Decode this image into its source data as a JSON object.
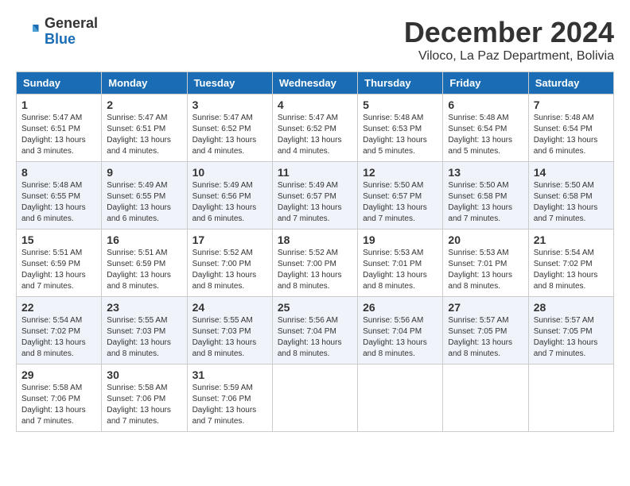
{
  "header": {
    "logo_general": "General",
    "logo_blue": "Blue",
    "month_title": "December 2024",
    "location": "Viloco, La Paz Department, Bolivia"
  },
  "weekdays": [
    "Sunday",
    "Monday",
    "Tuesday",
    "Wednesday",
    "Thursday",
    "Friday",
    "Saturday"
  ],
  "weeks": [
    [
      {
        "day": "1",
        "sunrise": "5:47 AM",
        "sunset": "6:51 PM",
        "daylight": "13 hours and 3 minutes."
      },
      {
        "day": "2",
        "sunrise": "5:47 AM",
        "sunset": "6:51 PM",
        "daylight": "13 hours and 4 minutes."
      },
      {
        "day": "3",
        "sunrise": "5:47 AM",
        "sunset": "6:52 PM",
        "daylight": "13 hours and 4 minutes."
      },
      {
        "day": "4",
        "sunrise": "5:47 AM",
        "sunset": "6:52 PM",
        "daylight": "13 hours and 4 minutes."
      },
      {
        "day": "5",
        "sunrise": "5:48 AM",
        "sunset": "6:53 PM",
        "daylight": "13 hours and 5 minutes."
      },
      {
        "day": "6",
        "sunrise": "5:48 AM",
        "sunset": "6:54 PM",
        "daylight": "13 hours and 5 minutes."
      },
      {
        "day": "7",
        "sunrise": "5:48 AM",
        "sunset": "6:54 PM",
        "daylight": "13 hours and 6 minutes."
      }
    ],
    [
      {
        "day": "8",
        "sunrise": "5:48 AM",
        "sunset": "6:55 PM",
        "daylight": "13 hours and 6 minutes."
      },
      {
        "day": "9",
        "sunrise": "5:49 AM",
        "sunset": "6:55 PM",
        "daylight": "13 hours and 6 minutes."
      },
      {
        "day": "10",
        "sunrise": "5:49 AM",
        "sunset": "6:56 PM",
        "daylight": "13 hours and 6 minutes."
      },
      {
        "day": "11",
        "sunrise": "5:49 AM",
        "sunset": "6:57 PM",
        "daylight": "13 hours and 7 minutes."
      },
      {
        "day": "12",
        "sunrise": "5:50 AM",
        "sunset": "6:57 PM",
        "daylight": "13 hours and 7 minutes."
      },
      {
        "day": "13",
        "sunrise": "5:50 AM",
        "sunset": "6:58 PM",
        "daylight": "13 hours and 7 minutes."
      },
      {
        "day": "14",
        "sunrise": "5:50 AM",
        "sunset": "6:58 PM",
        "daylight": "13 hours and 7 minutes."
      }
    ],
    [
      {
        "day": "15",
        "sunrise": "5:51 AM",
        "sunset": "6:59 PM",
        "daylight": "13 hours and 7 minutes."
      },
      {
        "day": "16",
        "sunrise": "5:51 AM",
        "sunset": "6:59 PM",
        "daylight": "13 hours and 8 minutes."
      },
      {
        "day": "17",
        "sunrise": "5:52 AM",
        "sunset": "7:00 PM",
        "daylight": "13 hours and 8 minutes."
      },
      {
        "day": "18",
        "sunrise": "5:52 AM",
        "sunset": "7:00 PM",
        "daylight": "13 hours and 8 minutes."
      },
      {
        "day": "19",
        "sunrise": "5:53 AM",
        "sunset": "7:01 PM",
        "daylight": "13 hours and 8 minutes."
      },
      {
        "day": "20",
        "sunrise": "5:53 AM",
        "sunset": "7:01 PM",
        "daylight": "13 hours and 8 minutes."
      },
      {
        "day": "21",
        "sunrise": "5:54 AM",
        "sunset": "7:02 PM",
        "daylight": "13 hours and 8 minutes."
      }
    ],
    [
      {
        "day": "22",
        "sunrise": "5:54 AM",
        "sunset": "7:02 PM",
        "daylight": "13 hours and 8 minutes."
      },
      {
        "day": "23",
        "sunrise": "5:55 AM",
        "sunset": "7:03 PM",
        "daylight": "13 hours and 8 minutes."
      },
      {
        "day": "24",
        "sunrise": "5:55 AM",
        "sunset": "7:03 PM",
        "daylight": "13 hours and 8 minutes."
      },
      {
        "day": "25",
        "sunrise": "5:56 AM",
        "sunset": "7:04 PM",
        "daylight": "13 hours and 8 minutes."
      },
      {
        "day": "26",
        "sunrise": "5:56 AM",
        "sunset": "7:04 PM",
        "daylight": "13 hours and 8 minutes."
      },
      {
        "day": "27",
        "sunrise": "5:57 AM",
        "sunset": "7:05 PM",
        "daylight": "13 hours and 8 minutes."
      },
      {
        "day": "28",
        "sunrise": "5:57 AM",
        "sunset": "7:05 PM",
        "daylight": "13 hours and 7 minutes."
      }
    ],
    [
      {
        "day": "29",
        "sunrise": "5:58 AM",
        "sunset": "7:06 PM",
        "daylight": "13 hours and 7 minutes."
      },
      {
        "day": "30",
        "sunrise": "5:58 AM",
        "sunset": "7:06 PM",
        "daylight": "13 hours and 7 minutes."
      },
      {
        "day": "31",
        "sunrise": "5:59 AM",
        "sunset": "7:06 PM",
        "daylight": "13 hours and 7 minutes."
      },
      null,
      null,
      null,
      null
    ]
  ],
  "labels": {
    "sunrise": "Sunrise:",
    "sunset": "Sunset:",
    "daylight": "Daylight:"
  }
}
